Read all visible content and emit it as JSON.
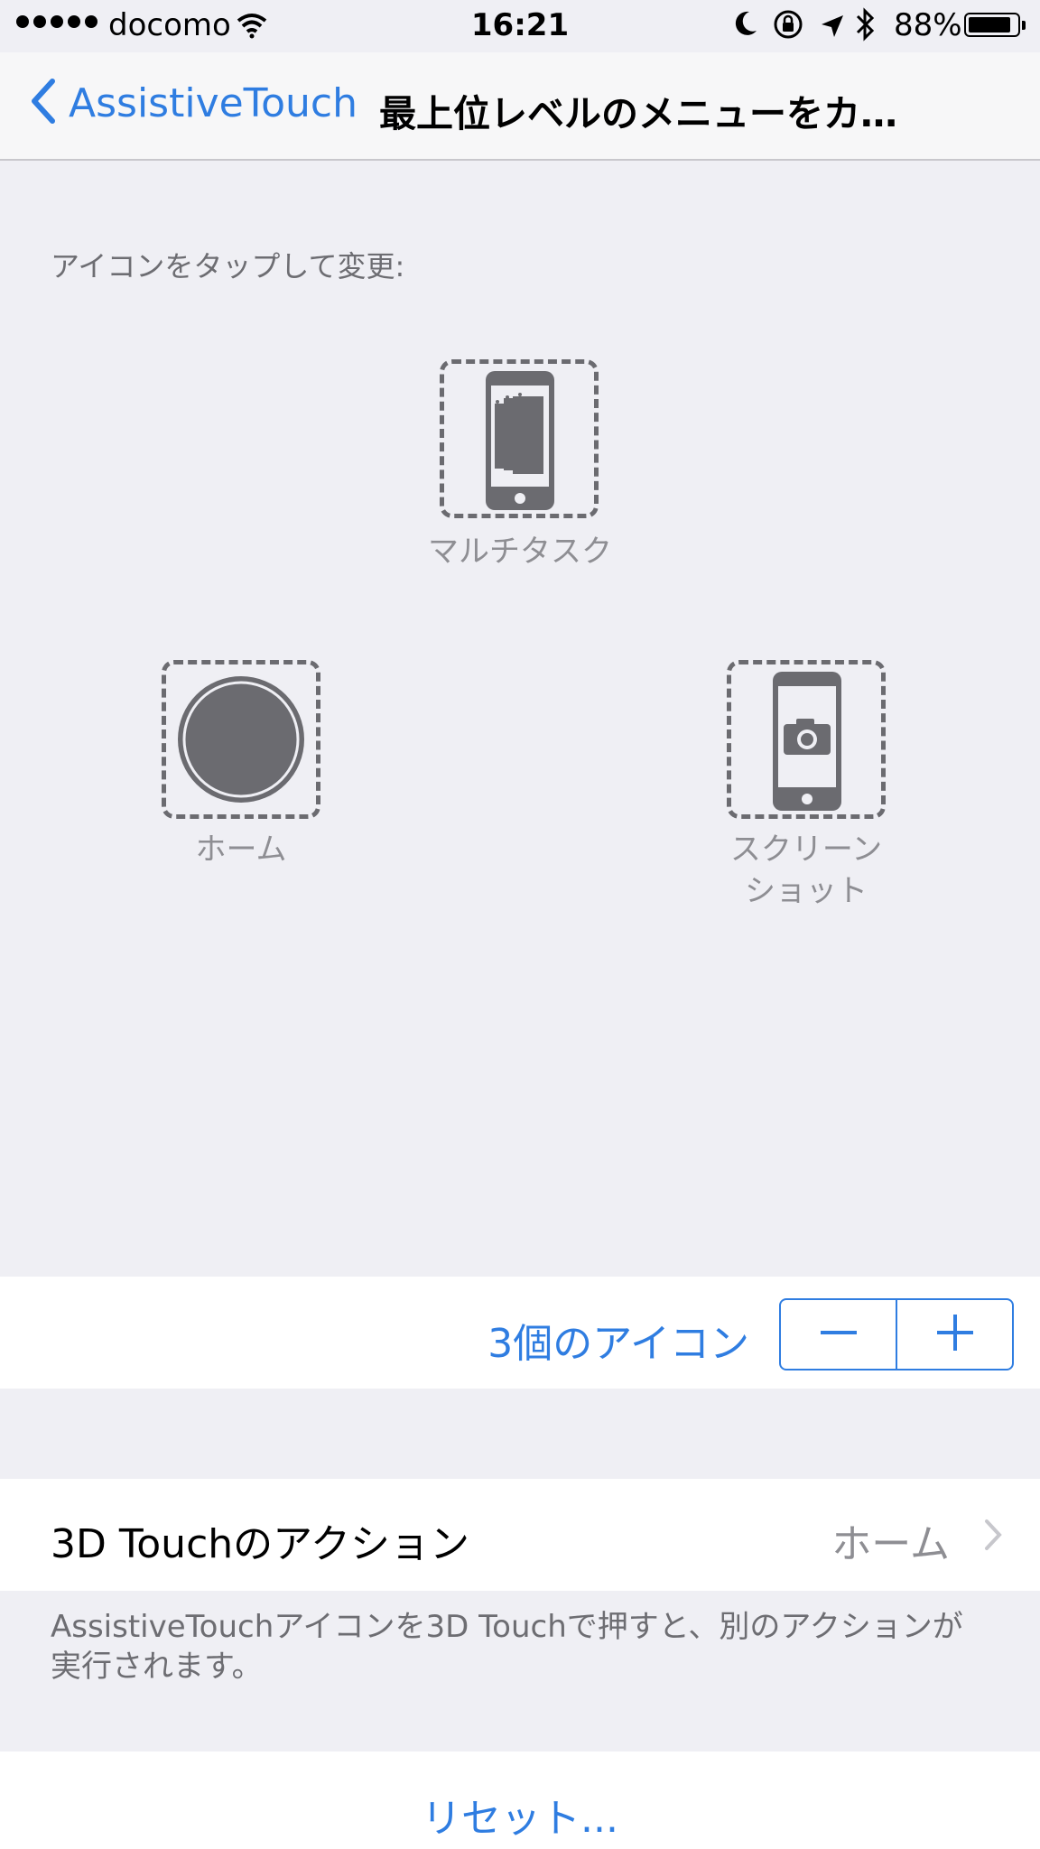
{
  "status_bar": {
    "carrier": "docomo",
    "time": "16:21",
    "battery_percent": "88%",
    "battery_level": 0.88
  },
  "nav": {
    "back_label": "AssistiveTouch",
    "title": "最上位レベルのメニューをカ…"
  },
  "menu": {
    "hint": "アイコンをタップして変更:",
    "slots": [
      {
        "label": "マルチタスク",
        "icon": "multitask-icon"
      },
      {
        "label": "ホーム",
        "icon": "home-button-icon"
      },
      {
        "label": "スクリーン\nショット",
        "icon": "screenshot-icon"
      }
    ]
  },
  "icon_count": {
    "label": "3個のアイコン",
    "minus": "−",
    "plus": "+"
  },
  "touch_action": {
    "label": "3D Touchのアクション",
    "value": "ホーム",
    "footer": "AssistiveTouchアイコンを3D Touchで押すと、別のアクションが実行されます。"
  },
  "reset": {
    "label": "リセット..."
  },
  "colors": {
    "accent": "#2f7de1",
    "background": "#efeff4",
    "icon_gray": "#6b6b70",
    "secondary_text": "#8e8e93"
  }
}
